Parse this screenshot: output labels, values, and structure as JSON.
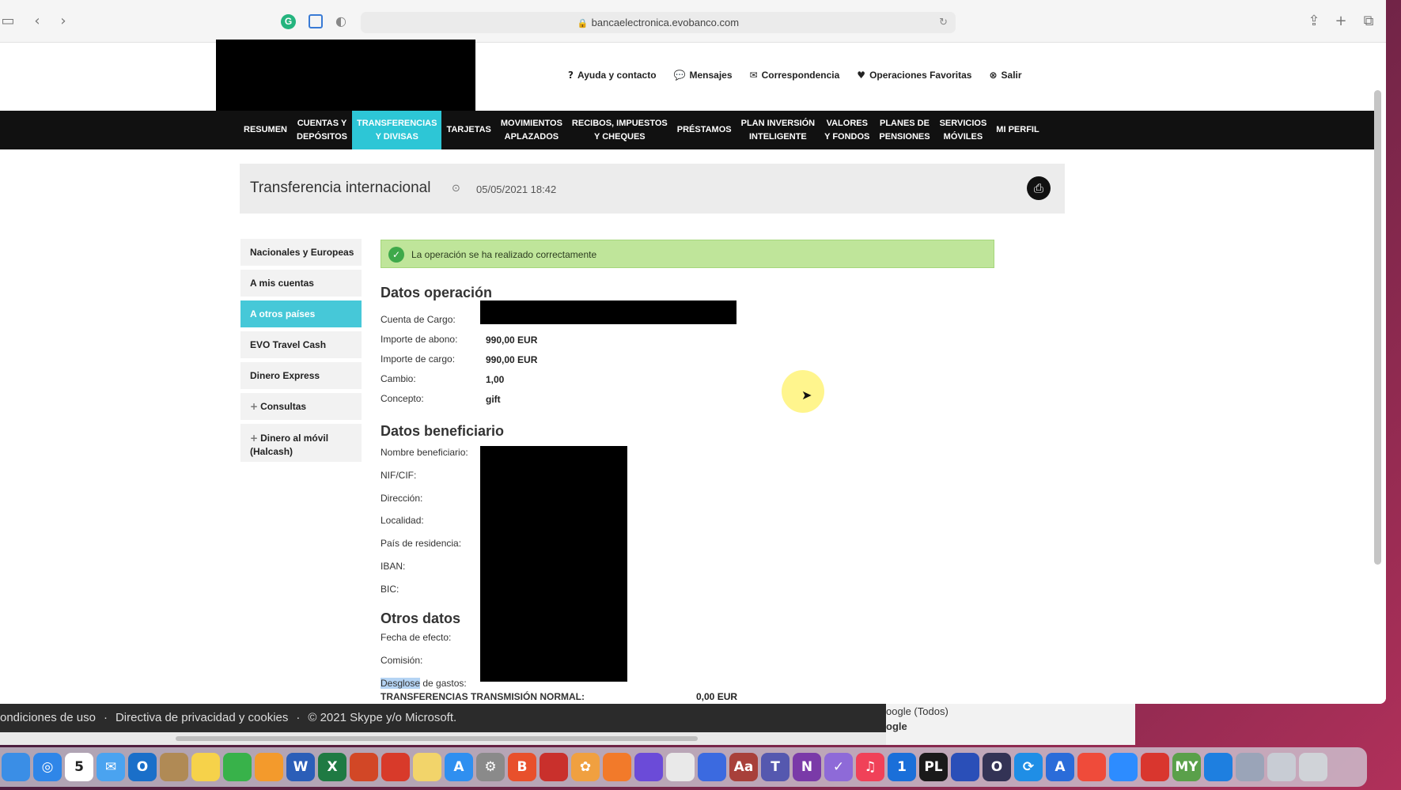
{
  "browser": {
    "url": "bancaelectronica.evobanco.com",
    "ext_g_label": "G"
  },
  "top_links": [
    {
      "icon": "question-icon",
      "glyph": "?",
      "label": "Ayuda y contacto"
    },
    {
      "icon": "chat-icon",
      "glyph": "💬",
      "label": "Mensajes"
    },
    {
      "icon": "envelope-icon",
      "glyph": "✉",
      "label": "Correspondencia"
    },
    {
      "icon": "heart-icon",
      "glyph": "♥",
      "label": "Operaciones Favoritas"
    },
    {
      "icon": "close-circle-icon",
      "glyph": "⊗",
      "label": "Salir"
    }
  ],
  "nav": [
    {
      "label": "RESUMEN",
      "active": false
    },
    {
      "label": "CUENTAS Y\nDEPÓSITOS",
      "active": false
    },
    {
      "label": "TRANSFERENCIAS\nY DIVISAS",
      "active": true
    },
    {
      "label": "TARJETAS",
      "active": false
    },
    {
      "label": "MOVIMIENTOS\nAPLAZADOS",
      "active": false
    },
    {
      "label": "RECIBOS, IMPUESTOS\nY CHEQUES",
      "active": false
    },
    {
      "label": "PRÉSTAMOS",
      "active": false
    },
    {
      "label": "PLAN INVERSIÓN\nINTELIGENTE",
      "active": false
    },
    {
      "label": "VALORES\nY FONDOS",
      "active": false
    },
    {
      "label": "PLANES DE\nPENSIONES",
      "active": false
    },
    {
      "label": "SERVICIOS\nMÓVILES",
      "active": false
    },
    {
      "label": "MI PERFIL",
      "active": false
    }
  ],
  "header": {
    "title": "Transferencia internacional",
    "datetime": "05/05/2021 18:42"
  },
  "side_menu": [
    {
      "label": "Nacionales y Europeas",
      "active": false,
      "plus": false
    },
    {
      "label": "A mis cuentas",
      "active": false,
      "plus": false
    },
    {
      "label": "A otros países",
      "active": true,
      "plus": false
    },
    {
      "label": "EVO Travel Cash",
      "active": false,
      "plus": false
    },
    {
      "label": "Dinero Express",
      "active": false,
      "plus": false
    },
    {
      "label": "Consultas",
      "active": false,
      "plus": true
    },
    {
      "label": "Dinero al móvil (Halcash)",
      "active": false,
      "plus": true
    }
  ],
  "success_message": "La operación se ha realizado correctamente",
  "datos_operacion": {
    "heading": "Datos operación",
    "rows": [
      {
        "label": "Cuenta de Cargo:",
        "value": ""
      },
      {
        "label": "Importe de abono:",
        "value": "990,00 EUR"
      },
      {
        "label": "Importe de cargo:",
        "value": "990,00 EUR"
      },
      {
        "label": "Cambio:",
        "value": "1,00"
      },
      {
        "label": "Concepto:",
        "value": "gift"
      }
    ]
  },
  "datos_beneficiario": {
    "heading": "Datos beneficiario",
    "labels": [
      "Nombre beneficiario:",
      "NIF/CIF:",
      "Dirección:",
      "Localidad:",
      "País de residencia:",
      "IBAN:",
      "BIC:"
    ]
  },
  "otros_datos": {
    "heading": "Otros datos",
    "labels": [
      "Fecha de efecto:",
      "Comisión:"
    ],
    "desglose_highlight": "Desglose",
    "desglose_rest": " de gastos:",
    "transfer_label": "TRANSFERENCIAS TRANSMISIÓN NORMAL:",
    "transfer_value": "0,00 EUR"
  },
  "skype": {
    "footer_items": [
      "ondiciones de uso",
      "·",
      "Directiva de privacidad y cookies",
      "·",
      "© 2021 Skype y/o Microsoft."
    ],
    "right_lines": [
      "oogle (Todos)",
      "ogle"
    ]
  },
  "dock": {
    "calendar_day": "5",
    "apps": [
      {
        "name": "finder-icon",
        "color": "#3a8ee6",
        "glyph": ""
      },
      {
        "name": "safari-icon",
        "color": "#2f86e8",
        "glyph": "◎"
      },
      {
        "name": "calendar-icon",
        "color": "#ffffff",
        "glyph": "5"
      },
      {
        "name": "mail-icon",
        "color": "#4aa3f0",
        "glyph": "✉"
      },
      {
        "name": "outlook-icon",
        "color": "#1a6fc9",
        "glyph": "O"
      },
      {
        "name": "contacts-icon",
        "color": "#b08a55",
        "glyph": ""
      },
      {
        "name": "notes-icon",
        "color": "#f6d24a",
        "glyph": ""
      },
      {
        "name": "numbers-icon",
        "color": "#38b24a",
        "glyph": ""
      },
      {
        "name": "pages-icon",
        "color": "#f39a2c",
        "glyph": ""
      },
      {
        "name": "word-icon",
        "color": "#2b5eb8",
        "glyph": "W"
      },
      {
        "name": "excel-icon",
        "color": "#1f7a43",
        "glyph": "X"
      },
      {
        "name": "powerpoint-icon",
        "color": "#d24726",
        "glyph": ""
      },
      {
        "name": "acrobat-icon",
        "color": "#d83a2a",
        "glyph": ""
      },
      {
        "name": "folder-icon",
        "color": "#f2d46a",
        "glyph": ""
      },
      {
        "name": "appstore-icon",
        "color": "#2f8ff0",
        "glyph": "A"
      },
      {
        "name": "settings-icon",
        "color": "#8a8a8a",
        "glyph": "⚙"
      },
      {
        "name": "brave-icon",
        "color": "#e8502c",
        "glyph": "B"
      },
      {
        "name": "vpn-icon",
        "color": "#c9302c",
        "glyph": ""
      },
      {
        "name": "photos-icon",
        "color": "#f0a040",
        "glyph": "✿"
      },
      {
        "name": "firefox-icon",
        "color": "#f27a2a",
        "glyph": ""
      },
      {
        "name": "firefox-dev-icon",
        "color": "#6b4bd8",
        "glyph": ""
      },
      {
        "name": "chrome-icon",
        "color": "#e9e9e9",
        "glyph": ""
      },
      {
        "name": "vectornator-icon",
        "color": "#3b6ae0",
        "glyph": ""
      },
      {
        "name": "dictionary-icon",
        "color": "#a8403a",
        "glyph": "Aa"
      },
      {
        "name": "teams-icon",
        "color": "#5558af",
        "glyph": "T"
      },
      {
        "name": "onenote-icon",
        "color": "#7a3aa8",
        "glyph": "N"
      },
      {
        "name": "tasks-icon",
        "color": "#8e6ad8",
        "glyph": "✓"
      },
      {
        "name": "music-icon",
        "color": "#f04158",
        "glyph": "♫"
      },
      {
        "name": "onepassword-icon",
        "color": "#1a6fd9",
        "glyph": "1"
      },
      {
        "name": "pycharm-icon",
        "color": "#1a1a1a",
        "glyph": "PL"
      },
      {
        "name": "affinity-icon",
        "color": "#2a4fb8",
        "glyph": ""
      },
      {
        "name": "ide-icon",
        "color": "#333355",
        "glyph": "O"
      },
      {
        "name": "sync-icon",
        "color": "#1f8ee6",
        "glyph": "⟳"
      },
      {
        "name": "translate-icon",
        "color": "#2a6cd9",
        "glyph": "A"
      },
      {
        "name": "anydesk-icon",
        "color": "#ef4b3a",
        "glyph": ""
      },
      {
        "name": "zoom-icon",
        "color": "#2d8cff",
        "glyph": ""
      },
      {
        "name": "screenshot-icon",
        "color": "#d9362e",
        "glyph": ""
      },
      {
        "name": "mypc-icon",
        "color": "#5aa04a",
        "glyph": "MY"
      },
      {
        "name": "teamviewer-icon",
        "color": "#1e7fe0",
        "glyph": ""
      },
      {
        "name": "preview-icon",
        "color": "#9aa4b8",
        "glyph": ""
      },
      {
        "name": "downloads-icon",
        "color": "#c8ccd4",
        "glyph": ""
      },
      {
        "name": "trash-icon",
        "color": "#d0d3d8",
        "glyph": ""
      }
    ]
  }
}
